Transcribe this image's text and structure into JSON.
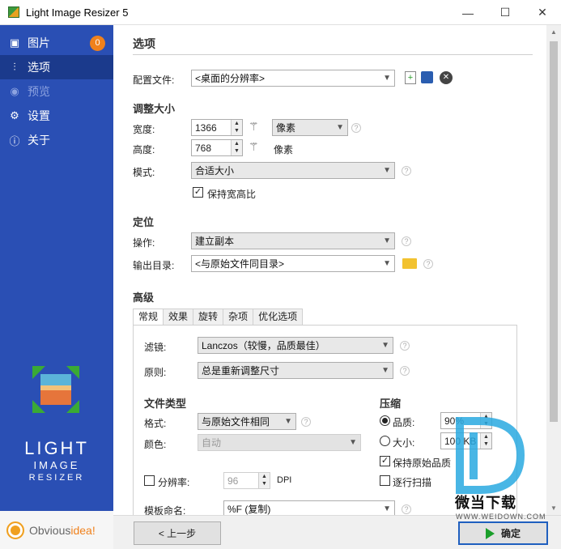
{
  "window": {
    "title": "Light Image Resizer 5",
    "min_glyph": "—",
    "max_glyph": "☐",
    "close_glyph": "✕"
  },
  "sidebar": {
    "items": [
      {
        "label": "图片",
        "icon": "images-icon",
        "badge": "0"
      },
      {
        "label": "选项",
        "icon": "sliders-icon",
        "active": true
      },
      {
        "label": "预览",
        "icon": "eye-icon",
        "disabled": true
      },
      {
        "label": "设置",
        "icon": "gear-icon"
      },
      {
        "label": "关于",
        "icon": "info-icon"
      }
    ],
    "logo_line1": "LIGHT",
    "logo_line2": "IMAGE",
    "logo_line3": "RESIZER",
    "brand_a": "Obvious",
    "brand_b": "idea!",
    "accent": "#2a4fb4"
  },
  "page": {
    "title": "选项",
    "profile_label": "配置文件:",
    "profile_value": "<桌面的分辨率>"
  },
  "resize": {
    "heading": "调整大小",
    "width_label": "宽度:",
    "width_value": "1366",
    "width_unit": "像素",
    "height_label": "高度:",
    "height_value": "768",
    "height_unit": "像素",
    "mode_label": "模式:",
    "mode_value": "合适大小",
    "keep_ratio_label": "保持宽高比",
    "keep_ratio_checked": true
  },
  "location": {
    "heading": "定位",
    "action_label": "操作:",
    "action_value": "建立副本",
    "output_label": "输出目录:",
    "output_value": "<与原始文件同目录>"
  },
  "advanced": {
    "heading": "高级",
    "tabs": [
      "常规",
      "效果",
      "旋转",
      "杂项",
      "优化选项"
    ],
    "filter_label": "滤镜:",
    "filter_value": "Lanczos（较慢，品质最佳）",
    "rule_label": "原则:",
    "rule_value": "总是重新调整尺寸",
    "filetype_heading": "文件类型",
    "format_label": "格式:",
    "format_value": "与原始文件相同",
    "color_label": "颜色:",
    "color_value": "自动",
    "resolution_label": "分辨率:",
    "resolution_value": "96",
    "resolution_unit": "DPI",
    "template_label": "模板命名:",
    "template_value": "%F (复制)",
    "compress_heading": "压缩",
    "quality_label": "品质:",
    "quality_value": "90%",
    "size_label": "大小:",
    "size_value": "100 KB",
    "keep_quality_label": "保持原始品质",
    "progressive_label": "逐行扫描"
  },
  "footer": {
    "back_label": "< 上一步",
    "ok_label": "确定"
  },
  "watermark": {
    "text": "微当下载",
    "url": "WWW.WEIDOWN.COM"
  }
}
